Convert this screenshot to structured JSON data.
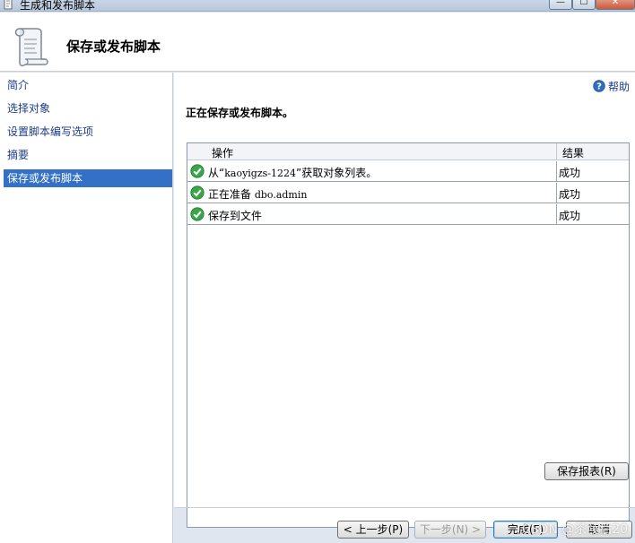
{
  "window": {
    "title": "生成和发布脚本",
    "minimize": "—",
    "maximize": "☐",
    "close": "✕"
  },
  "header": {
    "title": "保存或发布脚本",
    "icon": "scroll-script-icon"
  },
  "nav": {
    "items": [
      {
        "label": "简介"
      },
      {
        "label": "选择对象"
      },
      {
        "label": "设置脚本编写选项"
      },
      {
        "label": "摘要"
      },
      {
        "label": "保存或发布脚本",
        "active": true
      }
    ]
  },
  "main": {
    "help_label": "帮助",
    "status_heading": "正在保存或发布脚本。",
    "table": {
      "columns": [
        "操作",
        "结果"
      ],
      "rows": [
        {
          "op_prefix": "从“",
          "op_code": "kaoyigzs-1224",
          "op_suffix": "”获取对象列表。",
          "result": "成功"
        },
        {
          "op_prefix": "正在准备 ",
          "op_code": "dbo.admin",
          "op_suffix": "",
          "result": "成功"
        },
        {
          "op_prefix": "保存到文件",
          "op_code": "",
          "op_suffix": "",
          "result": "成功"
        }
      ]
    },
    "save_report_button": "保存报表(R)"
  },
  "footer": {
    "prev_button": "< 上一步(P)",
    "next_button": "下一步(N) >",
    "finish_button": "完成(F)",
    "cancel_button": "取消",
    "watermark": "CSDN @茶陵后20"
  },
  "colors": {
    "accent": "#3370c6",
    "link": "#1c3c8c",
    "success": "#3aa64a"
  }
}
